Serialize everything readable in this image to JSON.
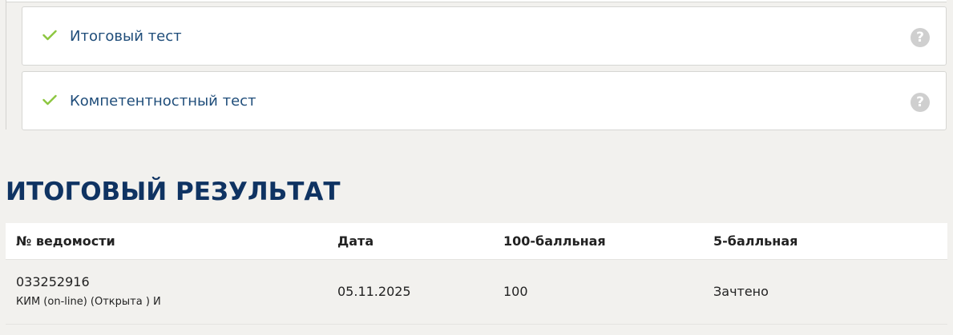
{
  "tests": [
    {
      "title": "Итоговый тест",
      "status_icon": "check-icon",
      "help_icon": "question-icon",
      "help_symbol": "?"
    },
    {
      "title": "Компетентностный тест",
      "status_icon": "check-icon",
      "help_icon": "question-icon",
      "help_symbol": "?"
    }
  ],
  "result": {
    "title": "ИТОГОВЫЙ РЕЗУЛЬТАТ",
    "columns": [
      "№ ведомости",
      "Дата",
      "100-балльная",
      "5-балльная"
    ],
    "rows": [
      {
        "sheet_number": "033252916",
        "sheet_description": "КИМ (on-line) (Открыта ) И",
        "date": "05.11.2025",
        "score_100": "100",
        "score_5": "Зачтено"
      }
    ]
  },
  "colors": {
    "check": "#8cc63f",
    "link_text": "#1f4d7a",
    "heading": "#0f3362",
    "background": "#f2f1ee",
    "help_icon_bg": "#cfcfcf"
  }
}
